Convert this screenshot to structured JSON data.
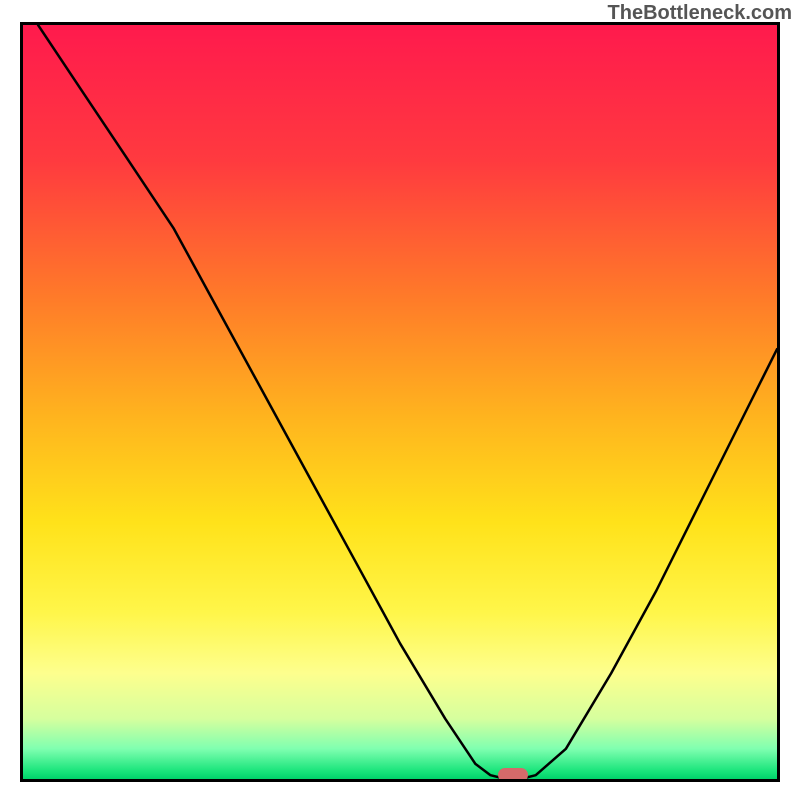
{
  "watermark": "TheBottleneck.com",
  "chart_data": {
    "type": "line",
    "title": "",
    "xlabel": "",
    "ylabel": "",
    "xlim": [
      0,
      100
    ],
    "ylim": [
      0,
      100
    ],
    "x": [
      2,
      8,
      14,
      20,
      26,
      32,
      38,
      44,
      50,
      56,
      60,
      62,
      64,
      66,
      68,
      72,
      78,
      84,
      90,
      96,
      100
    ],
    "values": [
      100,
      91,
      82,
      73,
      62,
      51,
      40,
      29,
      18,
      8,
      2,
      0.5,
      0,
      0,
      0.5,
      4,
      14,
      25,
      37,
      49,
      57
    ],
    "marker": {
      "x": 65,
      "y": 0.5,
      "color": "#d46a6a"
    }
  }
}
